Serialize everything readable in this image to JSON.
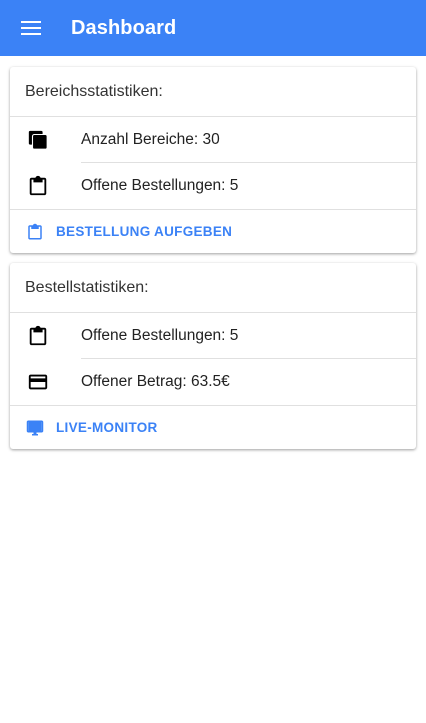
{
  "appbar": {
    "title": "Dashboard",
    "menu_icon": "menu-icon",
    "color": "#3b82f6"
  },
  "area_stats": {
    "heading": "Bereichsstatistiken:",
    "items": [
      {
        "icon": "layers-icon",
        "label": "Anzahl Bereiche: 30"
      },
      {
        "icon": "clipboard-icon",
        "label": "Offene Bestellungen: 5"
      }
    ],
    "action": {
      "icon": "clipboard-icon",
      "label": "BESTELLUNG AUFGEBEN"
    }
  },
  "order_stats": {
    "heading": "Bestellstatistiken:",
    "items": [
      {
        "icon": "clipboard-icon",
        "label": "Offene Bestellungen: 5"
      },
      {
        "icon": "credit-card-icon",
        "label": "Offener Betrag: 63.5€"
      }
    ],
    "action": {
      "icon": "monitor-icon",
      "label": "LIVE-MONITOR"
    }
  }
}
